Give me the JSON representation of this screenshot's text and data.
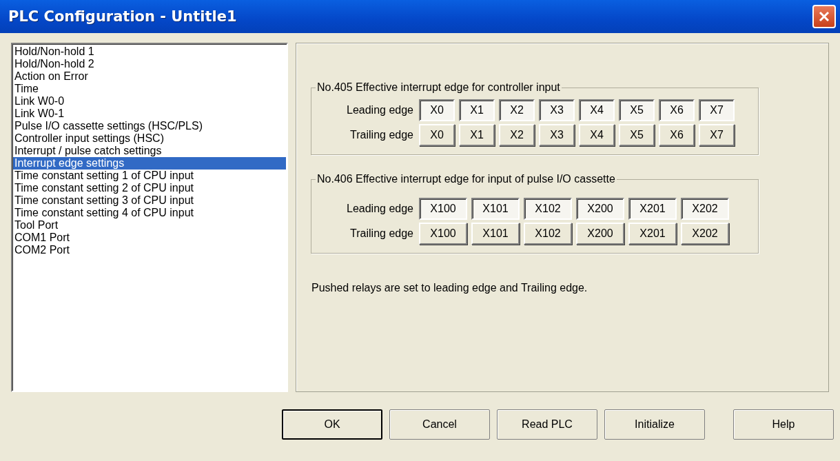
{
  "window": {
    "title": "PLC Configuration - Untitle1"
  },
  "sidebar": {
    "items": [
      {
        "label": "Hold/Non-hold 1",
        "selected": false
      },
      {
        "label": "Hold/Non-hold 2",
        "selected": false
      },
      {
        "label": "Action on Error",
        "selected": false
      },
      {
        "label": "Time",
        "selected": false
      },
      {
        "label": "Link W0-0",
        "selected": false
      },
      {
        "label": "Link W0-1",
        "selected": false
      },
      {
        "label": "Pulse I/O cassette settings (HSC/PLS)",
        "selected": false
      },
      {
        "label": "Controller input settings (HSC)",
        "selected": false
      },
      {
        "label": "Interrupt / pulse catch settings",
        "selected": false
      },
      {
        "label": "Interrupt edge settings",
        "selected": true
      },
      {
        "label": "Time constant setting 1 of CPU input",
        "selected": false
      },
      {
        "label": "Time constant setting 2 of CPU input",
        "selected": false
      },
      {
        "label": "Time constant setting 3 of CPU input",
        "selected": false
      },
      {
        "label": "Time constant setting 4 of CPU input",
        "selected": false
      },
      {
        "label": "Tool Port",
        "selected": false
      },
      {
        "label": "COM1 Port",
        "selected": false
      },
      {
        "label": "COM2 Port",
        "selected": false
      }
    ]
  },
  "groups": [
    {
      "title": "No.405 Effective interrupt edge for controller input",
      "rows": [
        {
          "label": "Leading edge",
          "relays": [
            {
              "label": "X0",
              "pushed": true
            },
            {
              "label": "X1",
              "pushed": true
            },
            {
              "label": "X2",
              "pushed": true
            },
            {
              "label": "X3",
              "pushed": true
            },
            {
              "label": "X4",
              "pushed": true
            },
            {
              "label": "X5",
              "pushed": true
            },
            {
              "label": "X6",
              "pushed": true
            },
            {
              "label": "X7",
              "pushed": true
            }
          ]
        },
        {
          "label": "Trailing edge",
          "relays": [
            {
              "label": "X0",
              "pushed": false
            },
            {
              "label": "X1",
              "pushed": false
            },
            {
              "label": "X2",
              "pushed": false
            },
            {
              "label": "X3",
              "pushed": false
            },
            {
              "label": "X4",
              "pushed": false
            },
            {
              "label": "X5",
              "pushed": false
            },
            {
              "label": "X6",
              "pushed": false
            },
            {
              "label": "X7",
              "pushed": false
            }
          ]
        }
      ]
    },
    {
      "title": "No.406 Effective interrupt edge for input of pulse I/O cassette",
      "rows": [
        {
          "label": "Leading edge",
          "relays": [
            {
              "label": "X100",
              "pushed": true
            },
            {
              "label": "X101",
              "pushed": true
            },
            {
              "label": "X102",
              "pushed": true
            },
            {
              "label": "X200",
              "pushed": true
            },
            {
              "label": "X201",
              "pushed": true
            },
            {
              "label": "X202",
              "pushed": true
            }
          ]
        },
        {
          "label": "Trailing edge",
          "relays": [
            {
              "label": "X100",
              "pushed": false
            },
            {
              "label": "X101",
              "pushed": false
            },
            {
              "label": "X102",
              "pushed": false
            },
            {
              "label": "X200",
              "pushed": false
            },
            {
              "label": "X201",
              "pushed": false
            },
            {
              "label": "X202",
              "pushed": false
            }
          ]
        }
      ]
    }
  ],
  "note": "Pushed relays are set to leading edge and Trailing edge.",
  "buttons": [
    {
      "label": "OK",
      "default": true
    },
    {
      "label": "Cancel",
      "default": false
    },
    {
      "label": "Read PLC",
      "default": false
    },
    {
      "label": "Initialize",
      "default": false
    },
    {
      "label": "Help",
      "default": false
    }
  ]
}
